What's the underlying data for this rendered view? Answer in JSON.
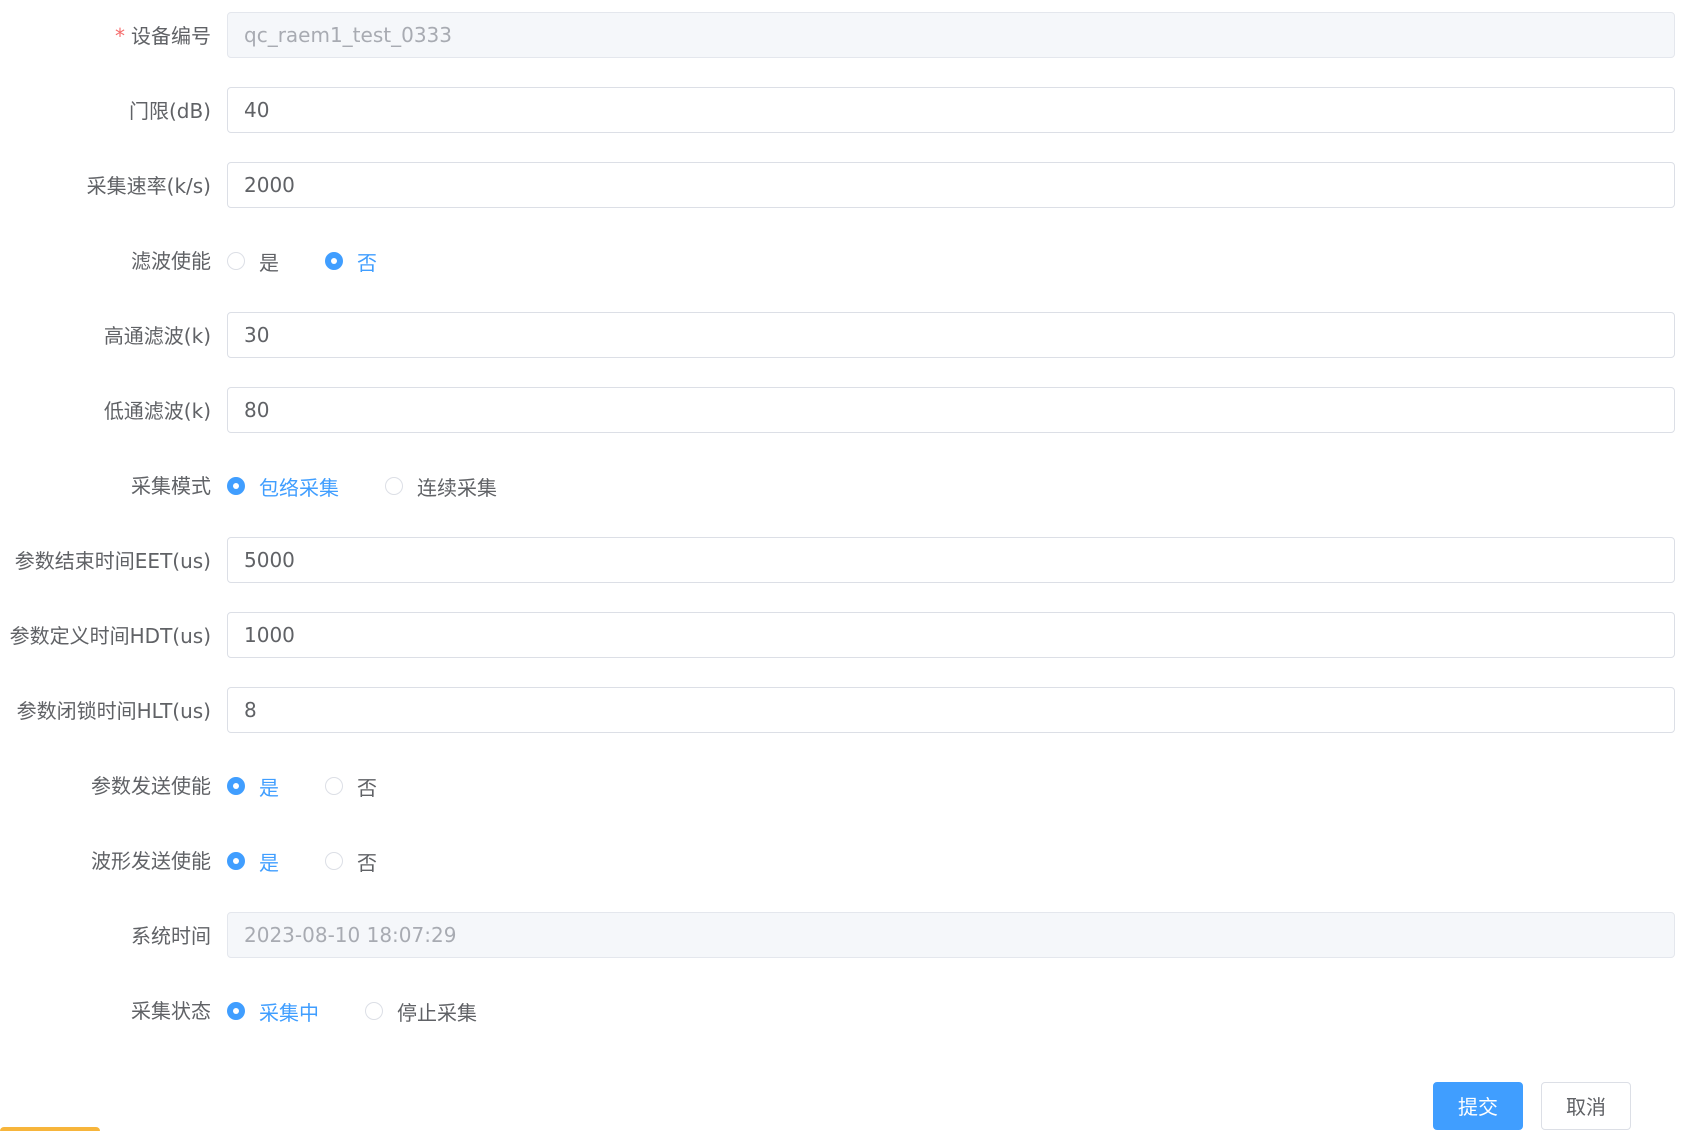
{
  "form": {
    "device_id": {
      "label": "设备编号",
      "required_mark": "*",
      "value": "qc_raem1_test_0333"
    },
    "threshold": {
      "label": "门限(dB)",
      "value": "40"
    },
    "sample_rate": {
      "label": "采集速率(k/s)",
      "value": "2000"
    },
    "filter_enable": {
      "label": "滤波使能",
      "options": [
        "是",
        "否"
      ],
      "selected": "否"
    },
    "high_pass": {
      "label": "高通滤波(k)",
      "value": "30"
    },
    "low_pass": {
      "label": "低通滤波(k)",
      "value": "80"
    },
    "acquire_mode": {
      "label": "采集模式",
      "options": [
        "包络采集",
        "连续采集"
      ],
      "selected": "包络采集"
    },
    "eet": {
      "label": "参数结束时间EET(us)",
      "value": "5000"
    },
    "hdt": {
      "label": "参数定义时间HDT(us)",
      "value": "1000"
    },
    "hlt": {
      "label": "参数闭锁时间HLT(us)",
      "value": "8"
    },
    "param_send": {
      "label": "参数发送使能",
      "options": [
        "是",
        "否"
      ],
      "selected": "是"
    },
    "wave_send": {
      "label": "波形发送使能",
      "options": [
        "是",
        "否"
      ],
      "selected": "是"
    },
    "system_time": {
      "label": "系统时间",
      "value": "2023-08-10 18:07:29"
    },
    "acquire_status": {
      "label": "采集状态",
      "options": [
        "采集中",
        "停止采集"
      ],
      "selected": "采集中"
    }
  },
  "actions": {
    "submit_label": "提交",
    "cancel_label": "取消"
  },
  "colors": {
    "primary": "#409eff",
    "required": "#f56c6c",
    "text": "#606266",
    "disabled_bg": "#f5f7fa"
  }
}
